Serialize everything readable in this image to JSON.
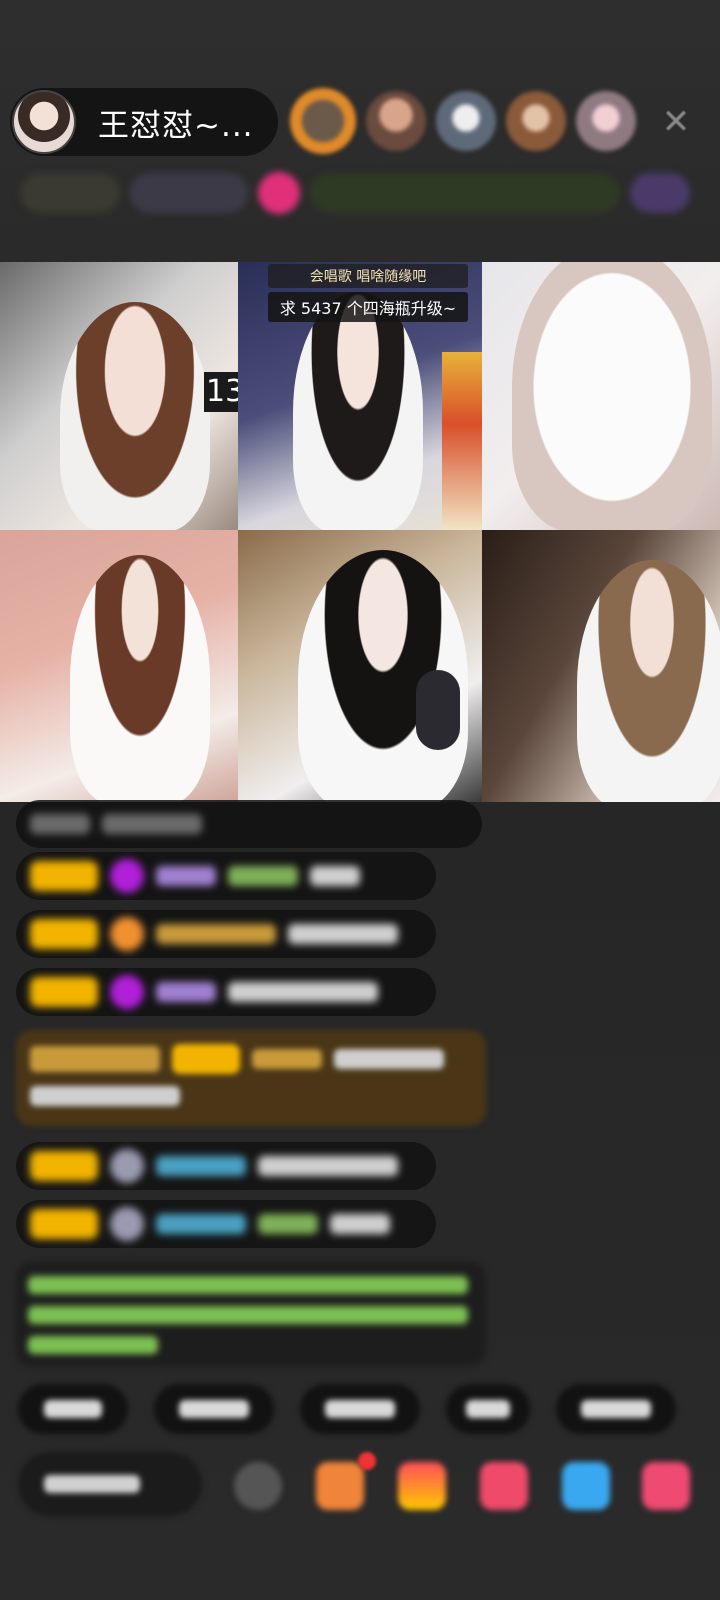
{
  "header": {
    "host_name": "王怼怼~...",
    "close_label": "✕"
  },
  "grid": {
    "cell1_badge": "13",
    "cell2_banner_top": "会唱歌    唱啥随缘吧",
    "cell2_banner_bottom": "求 5437 个四海瓶升级~"
  },
  "colors": {
    "level_badge": "#f2b400",
    "gem_purple": "#b020d8",
    "gift_accent": "#f0843a",
    "golden_message_bg": "#4a3617",
    "system_green": "#7cbf52"
  },
  "icons": [
    "close-icon",
    "emoji-icon",
    "gift-icon",
    "bag-icon",
    "heart-icon",
    "game-icon",
    "more-icon"
  ]
}
